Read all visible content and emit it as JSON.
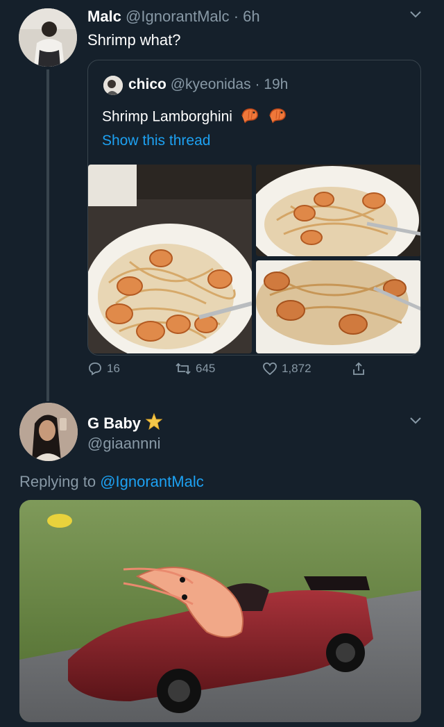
{
  "tweet1": {
    "display_name": "Malc",
    "handle": "@IgnorantMalc",
    "separator": "·",
    "time": "6h",
    "text": "Shrimp what?",
    "menu_icon": "chevron-down-icon",
    "quoted": {
      "display_name": "chico",
      "handle": "@kyeonidas",
      "separator": "·",
      "time": "19h",
      "text": "Shrimp Lamborghini",
      "emojis": [
        "shrimp-icon",
        "shrimp-icon"
      ],
      "link": "Show this thread"
    },
    "actions": {
      "replies": "16",
      "retweets": "645",
      "likes": "1,872"
    }
  },
  "tweet2": {
    "display_name": "G Baby",
    "badge_icon": "star-icon",
    "handle": "@giaannni",
    "menu_icon": "chevron-down-icon",
    "replying_prefix": "Replying to",
    "replying_to": "@IgnorantMalc"
  },
  "colors": {
    "background": "#15202b",
    "muted": "#8899a6",
    "link": "#1da1f2",
    "border": "#38444d"
  }
}
